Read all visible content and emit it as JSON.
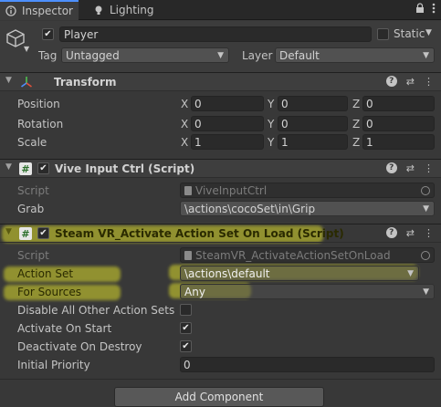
{
  "tabs": [
    {
      "label": "Inspector",
      "icon": "info-icon",
      "active": true
    },
    {
      "label": "Lighting",
      "icon": "lightbulb-icon",
      "active": false
    }
  ],
  "tabbar_icons": [
    "lock-icon",
    "kebab-menu-icon"
  ],
  "gameobject": {
    "active": true,
    "name": "Player",
    "static_label": "Static",
    "tag_label": "Tag",
    "tag_value": "Untagged",
    "layer_label": "Layer",
    "layer_value": "Default"
  },
  "transform": {
    "title": "Transform",
    "rows": [
      {
        "label": "Position",
        "x": "0",
        "y": "0",
        "z": "0"
      },
      {
        "label": "Rotation",
        "x": "0",
        "y": "0",
        "z": "0"
      },
      {
        "label": "Scale",
        "x": "1",
        "y": "1",
        "z": "1"
      }
    ],
    "axis": {
      "x": "X",
      "y": "Y",
      "z": "Z"
    }
  },
  "vive": {
    "title": "Vive Input Ctrl (Script)",
    "enabled": true,
    "script_label": "Script",
    "script_value": "ViveInputCtrl",
    "grab_label": "Grab",
    "grab_value": "\\actions\\cocoSet\\in\\Grip"
  },
  "steamvr": {
    "title": "Steam VR_Activate Action Set On Load (Script)",
    "enabled": true,
    "script_label": "Script",
    "script_value": "SteamVR_ActivateActionSetOnLoad",
    "action_set_label": "Action Set",
    "action_set_value": "\\actions\\default",
    "for_sources_label": "For Sources",
    "for_sources_value": "Any",
    "disable_all_label": "Disable All Other Action Sets",
    "disable_all": false,
    "activate_on_start_label": "Activate On Start",
    "activate_on_start": true,
    "deactivate_on_destroy_label": "Deactivate On Destroy",
    "deactivate_on_destroy": true,
    "initial_priority_label": "Initial Priority",
    "initial_priority_value": "0"
  },
  "add_component_label": "Add Component",
  "colors": {
    "highlight": "#dada2a",
    "accent": "#4d90fe",
    "background": "#383838"
  }
}
